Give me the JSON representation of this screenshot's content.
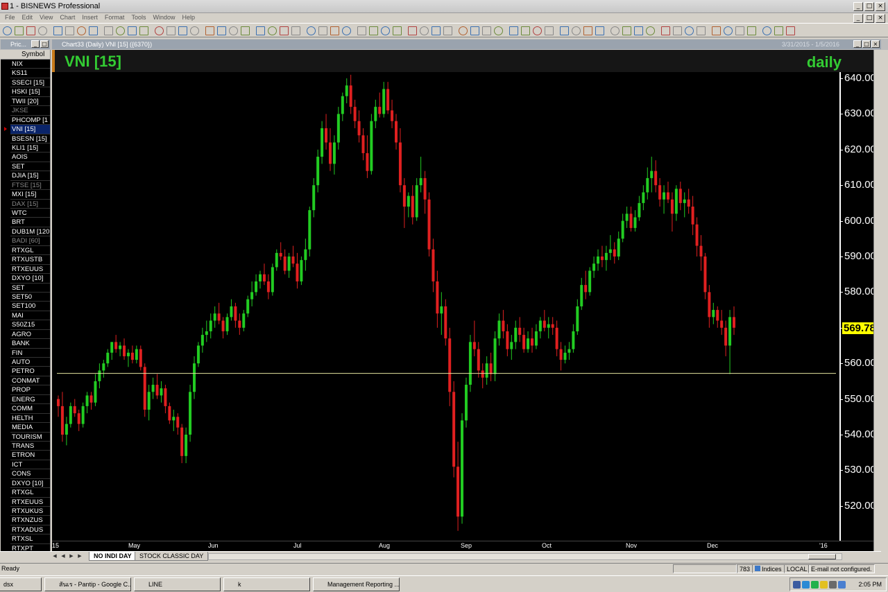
{
  "app": {
    "title": "1 - BISNEWS Professional"
  },
  "menu": [
    "File",
    "Edit",
    "View",
    "Chart",
    "Insert",
    "Format",
    "Tools",
    "Window",
    "Help"
  ],
  "panels": {
    "price_title": "Pric...",
    "symbol_header": "Symbol",
    "symbols": [
      {
        "label": "NIX",
        "state": "normal"
      },
      {
        "label": "KS11",
        "state": "normal"
      },
      {
        "label": "SSECI [15]",
        "state": "normal"
      },
      {
        "label": "HSKI [15]",
        "state": "normal"
      },
      {
        "label": "TWII [20]",
        "state": "normal"
      },
      {
        "label": "JKSE",
        "state": "dim"
      },
      {
        "label": "PHCOMP [1",
        "state": "normal"
      },
      {
        "label": "VNI [15]",
        "state": "selected"
      },
      {
        "label": "BSESN [15]",
        "state": "normal"
      },
      {
        "label": "KLI1 [15]",
        "state": "normal"
      },
      {
        "label": "AOIS",
        "state": "normal"
      },
      {
        "label": "SET",
        "state": "normal"
      },
      {
        "label": "DJIA [15]",
        "state": "normal"
      },
      {
        "label": "FTSE [15]",
        "state": "dim"
      },
      {
        "label": "MXI [15]",
        "state": "normal"
      },
      {
        "label": "DAX [15]",
        "state": "dim"
      },
      {
        "label": "WTC",
        "state": "normal"
      },
      {
        "label": "BRT",
        "state": "normal"
      },
      {
        "label": "DUB1M [120",
        "state": "normal"
      },
      {
        "label": "BADI [60]",
        "state": "dim"
      },
      {
        "label": "RTXGL",
        "state": "normal"
      },
      {
        "label": "RTXUSTB",
        "state": "normal"
      },
      {
        "label": "RTXEUUS",
        "state": "normal"
      },
      {
        "label": "DXYO [10]",
        "state": "normal"
      },
      {
        "label": "SET",
        "state": "normal"
      },
      {
        "label": "SET50",
        "state": "normal"
      },
      {
        "label": "SET100",
        "state": "normal"
      },
      {
        "label": "MAI",
        "state": "normal"
      },
      {
        "label": "S50Z15",
        "state": "normal"
      },
      {
        "label": "AGRO",
        "state": "normal"
      },
      {
        "label": "BANK",
        "state": "normal"
      },
      {
        "label": "FIN",
        "state": "normal"
      },
      {
        "label": "AUTO",
        "state": "normal"
      },
      {
        "label": "PETRO",
        "state": "normal"
      },
      {
        "label": "CONMAT",
        "state": "normal"
      },
      {
        "label": "PROP",
        "state": "normal"
      },
      {
        "label": "ENERG",
        "state": "normal"
      },
      {
        "label": "COMM",
        "state": "normal"
      },
      {
        "label": "HELTH",
        "state": "normal"
      },
      {
        "label": "MEDIA",
        "state": "normal"
      },
      {
        "label": "TOURISM",
        "state": "normal"
      },
      {
        "label": "TRANS",
        "state": "normal"
      },
      {
        "label": "ETRON",
        "state": "normal"
      },
      {
        "label": "ICT",
        "state": "normal"
      },
      {
        "label": "CONS",
        "state": "normal"
      },
      {
        "label": "DXYO [10]",
        "state": "normal"
      },
      {
        "label": "RTXGL",
        "state": "normal"
      },
      {
        "label": "RTXEUUS",
        "state": "normal"
      },
      {
        "label": "RTXUKUS",
        "state": "normal"
      },
      {
        "label": "RTXNZUS",
        "state": "normal"
      },
      {
        "label": "RTXADUS",
        "state": "normal"
      },
      {
        "label": "RTXSL",
        "state": "normal"
      },
      {
        "label": "RTXPT",
        "state": "normal"
      }
    ]
  },
  "chart_window": {
    "title": "Chart33 (Daily) VNI [15] ({6370})",
    "range": "3/31/2015 - 1/5/2016",
    "symbol_label": "VNI [15]",
    "period_label": "daily"
  },
  "chart_data": {
    "type": "candlestick",
    "ylim": [
      512,
      641
    ],
    "yticks": [
      640,
      630,
      620,
      610,
      600,
      590,
      580,
      570,
      560,
      550,
      540,
      530,
      520
    ],
    "ytick_labels": [
      "640.00",
      "630.00",
      "620.00",
      "610.00",
      "600.00",
      "590.00",
      "580.00",
      "570.00",
      "560.00",
      "550.00",
      "540.00",
      "530.00",
      "520.00"
    ],
    "last_price_label": "569.78",
    "last_price": 569.78,
    "horizontal_line": 557.2,
    "xlabels": [
      "15",
      "May",
      "Jun",
      "Jul",
      "Aug",
      "Sep",
      "Oct",
      "Nov",
      "Dec",
      "'16"
    ],
    "colors": {
      "up": "#22cc22",
      "down": "#e02020",
      "line": "#e6e6a0",
      "axis": "#ffffff",
      "last_bg": "#ffff00"
    },
    "candles": [
      [
        550,
        551,
        545,
        548
      ],
      [
        548,
        552,
        538,
        540
      ],
      [
        540,
        545,
        537,
        543
      ],
      [
        543,
        549,
        542,
        548
      ],
      [
        548,
        550,
        545,
        546
      ],
      [
        546,
        547,
        541,
        543
      ],
      [
        543,
        549,
        542,
        548
      ],
      [
        548,
        552,
        546,
        551
      ],
      [
        551,
        552,
        547,
        549
      ],
      [
        549,
        557,
        548,
        555
      ],
      [
        555,
        560,
        553,
        558
      ],
      [
        558,
        561,
        556,
        560
      ],
      [
        560,
        564,
        559,
        563
      ],
      [
        563,
        566,
        561,
        566
      ],
      [
        566,
        568,
        563,
        564
      ],
      [
        564,
        566,
        562,
        565
      ],
      [
        565,
        567,
        561,
        562
      ],
      [
        562,
        564,
        559,
        563
      ],
      [
        563,
        565,
        560,
        561
      ],
      [
        561,
        565,
        560,
        564
      ],
      [
        564,
        565,
        558,
        559
      ],
      [
        559,
        560,
        545,
        547
      ],
      [
        547,
        554,
        544,
        552
      ],
      [
        552,
        556,
        550,
        554
      ],
      [
        554,
        557,
        550,
        551
      ],
      [
        551,
        555,
        549,
        553
      ],
      [
        553,
        554,
        546,
        548
      ],
      [
        548,
        549,
        543,
        544
      ],
      [
        544,
        547,
        541,
        545
      ],
      [
        545,
        546,
        540,
        542
      ],
      [
        542,
        543,
        532,
        534
      ],
      [
        534,
        542,
        532,
        540
      ],
      [
        540,
        554,
        538,
        552
      ],
      [
        552,
        562,
        550,
        560
      ],
      [
        560,
        566,
        559,
        565
      ],
      [
        565,
        570,
        563,
        568
      ],
      [
        568,
        572,
        566,
        569
      ],
      [
        569,
        574,
        567,
        572
      ],
      [
        572,
        576,
        570,
        574
      ],
      [
        574,
        577,
        571,
        572
      ],
      [
        572,
        573,
        567,
        569
      ],
      [
        569,
        574,
        568,
        573
      ],
      [
        573,
        578,
        572,
        576
      ],
      [
        576,
        577,
        570,
        572
      ],
      [
        572,
        574,
        568,
        570
      ],
      [
        570,
        575,
        569,
        574
      ],
      [
        574,
        579,
        573,
        578
      ],
      [
        578,
        583,
        576,
        580
      ],
      [
        580,
        585,
        579,
        583
      ],
      [
        583,
        586,
        581,
        585
      ],
      [
        585,
        588,
        582,
        583
      ],
      [
        583,
        585,
        578,
        580
      ],
      [
        580,
        588,
        579,
        587
      ],
      [
        587,
        592,
        586,
        591
      ],
      [
        591,
        594,
        589,
        590
      ],
      [
        590,
        592,
        585,
        586
      ],
      [
        586,
        591,
        584,
        590
      ],
      [
        590,
        593,
        587,
        588
      ],
      [
        588,
        591,
        581,
        583
      ],
      [
        583,
        590,
        582,
        589
      ],
      [
        589,
        595,
        586,
        592
      ],
      [
        592,
        604,
        590,
        603
      ],
      [
        603,
        612,
        601,
        610
      ],
      [
        610,
        620,
        608,
        618
      ],
      [
        618,
        628,
        616,
        626
      ],
      [
        626,
        630,
        620,
        622
      ],
      [
        622,
        626,
        614,
        616
      ],
      [
        616,
        624,
        613,
        622
      ],
      [
        622,
        632,
        620,
        630
      ],
      [
        630,
        636,
        628,
        635
      ],
      [
        635,
        640,
        633,
        638
      ],
      [
        638,
        641,
        630,
        632
      ],
      [
        632,
        634,
        626,
        628
      ],
      [
        628,
        631,
        622,
        624
      ],
      [
        624,
        626,
        617,
        619
      ],
      [
        619,
        624,
        612,
        614
      ],
      [
        614,
        630,
        613,
        628
      ],
      [
        628,
        634,
        626,
        632
      ],
      [
        632,
        636,
        629,
        630
      ],
      [
        630,
        639,
        629,
        637
      ],
      [
        637,
        639,
        630,
        631
      ],
      [
        631,
        634,
        626,
        628
      ],
      [
        628,
        630,
        620,
        622
      ],
      [
        622,
        626,
        608,
        610
      ],
      [
        610,
        612,
        598,
        604
      ],
      [
        604,
        608,
        601,
        607
      ],
      [
        607,
        610,
        599,
        601
      ],
      [
        601,
        612,
        600,
        610
      ],
      [
        610,
        618,
        608,
        612
      ],
      [
        612,
        614,
        602,
        606
      ],
      [
        606,
        608,
        590,
        592
      ],
      [
        592,
        595,
        580,
        583
      ],
      [
        583,
        586,
        570,
        574
      ],
      [
        574,
        580,
        568,
        576
      ],
      [
        576,
        578,
        565,
        567
      ],
      [
        567,
        570,
        548,
        552
      ],
      [
        552,
        555,
        528,
        531
      ],
      [
        531,
        538,
        513,
        517
      ],
      [
        517,
        546,
        515,
        544
      ],
      [
        544,
        556,
        542,
        554
      ],
      [
        554,
        568,
        552,
        566
      ],
      [
        566,
        572,
        562,
        564
      ],
      [
        564,
        566,
        556,
        558
      ],
      [
        558,
        560,
        553,
        556
      ],
      [
        556,
        562,
        554,
        560
      ],
      [
        560,
        563,
        555,
        557
      ],
      [
        557,
        569,
        555,
        567
      ],
      [
        567,
        574,
        565,
        572
      ],
      [
        572,
        575,
        567,
        569
      ],
      [
        569,
        571,
        562,
        564
      ],
      [
        564,
        568,
        561,
        566
      ],
      [
        566,
        572,
        564,
        570
      ],
      [
        570,
        573,
        566,
        568
      ],
      [
        568,
        570,
        563,
        564
      ],
      [
        564,
        569,
        563,
        567
      ],
      [
        567,
        570,
        563,
        565
      ],
      [
        565,
        571,
        564,
        569
      ],
      [
        569,
        573,
        567,
        572
      ],
      [
        572,
        575,
        569,
        570
      ],
      [
        570,
        573,
        567,
        571
      ],
      [
        571,
        573,
        568,
        570
      ],
      [
        570,
        572,
        562,
        564
      ],
      [
        564,
        566,
        558,
        561
      ],
      [
        561,
        565,
        560,
        563
      ],
      [
        563,
        566,
        561,
        564
      ],
      [
        564,
        571,
        563,
        569
      ],
      [
        569,
        578,
        568,
        576
      ],
      [
        576,
        584,
        575,
        582
      ],
      [
        582,
        586,
        578,
        580
      ],
      [
        580,
        587,
        579,
        586
      ],
      [
        586,
        590,
        584,
        588
      ],
      [
        588,
        592,
        586,
        590
      ],
      [
        590,
        593,
        587,
        589
      ],
      [
        589,
        593,
        586,
        591
      ],
      [
        591,
        596,
        589,
        592
      ],
      [
        592,
        594,
        588,
        590
      ],
      [
        590,
        597,
        589,
        595
      ],
      [
        595,
        602,
        594,
        600
      ],
      [
        600,
        604,
        598,
        602
      ],
      [
        602,
        604,
        597,
        598
      ],
      [
        598,
        603,
        597,
        601
      ],
      [
        601,
        607,
        600,
        605
      ],
      [
        605,
        610,
        603,
        608
      ],
      [
        608,
        615,
        606,
        612
      ],
      [
        612,
        618,
        608,
        614
      ],
      [
        614,
        617,
        608,
        610
      ],
      [
        610,
        612,
        604,
        606
      ],
      [
        606,
        610,
        602,
        608
      ],
      [
        608,
        611,
        605,
        606
      ],
      [
        606,
        608,
        597,
        602
      ],
      [
        602,
        610,
        600,
        609
      ],
      [
        609,
        611,
        603,
        605
      ],
      [
        605,
        608,
        601,
        606
      ],
      [
        606,
        609,
        602,
        604
      ],
      [
        604,
        607,
        596,
        599
      ],
      [
        599,
        601,
        590,
        593
      ],
      [
        593,
        596,
        586,
        590
      ],
      [
        590,
        591,
        578,
        580
      ],
      [
        580,
        582,
        570,
        573
      ],
      [
        573,
        577,
        571,
        575
      ],
      [
        575,
        576,
        570,
        572
      ],
      [
        572,
        575,
        568,
        570
      ],
      [
        570,
        572,
        562,
        565
      ],
      [
        565,
        575,
        557,
        573
      ],
      [
        573,
        576,
        568,
        570
      ]
    ]
  },
  "tabs": [
    {
      "label": "NO INDI DAY",
      "active": true
    },
    {
      "label": "STOCK CLASSIC DAY",
      "active": false
    }
  ],
  "status": {
    "left": "Ready",
    "count": "783",
    "indices": "Indices",
    "local": "LOCAL",
    "email": "E-mail not configured."
  },
  "taskbar": {
    "items": [
      {
        "label": "dsx",
        "icon_color": "#8a8a8a"
      },
      {
        "label": "สันเร - Pantip - Google C...",
        "icon_color": "#e8a020"
      },
      {
        "label": "LINE",
        "icon_color": "#22b14c"
      },
      {
        "label": "k",
        "icon_color": "#22b14c"
      },
      {
        "label": "Management Reporting ...",
        "icon_color": "#3c78c8"
      }
    ],
    "clock": "2:05 PM"
  }
}
